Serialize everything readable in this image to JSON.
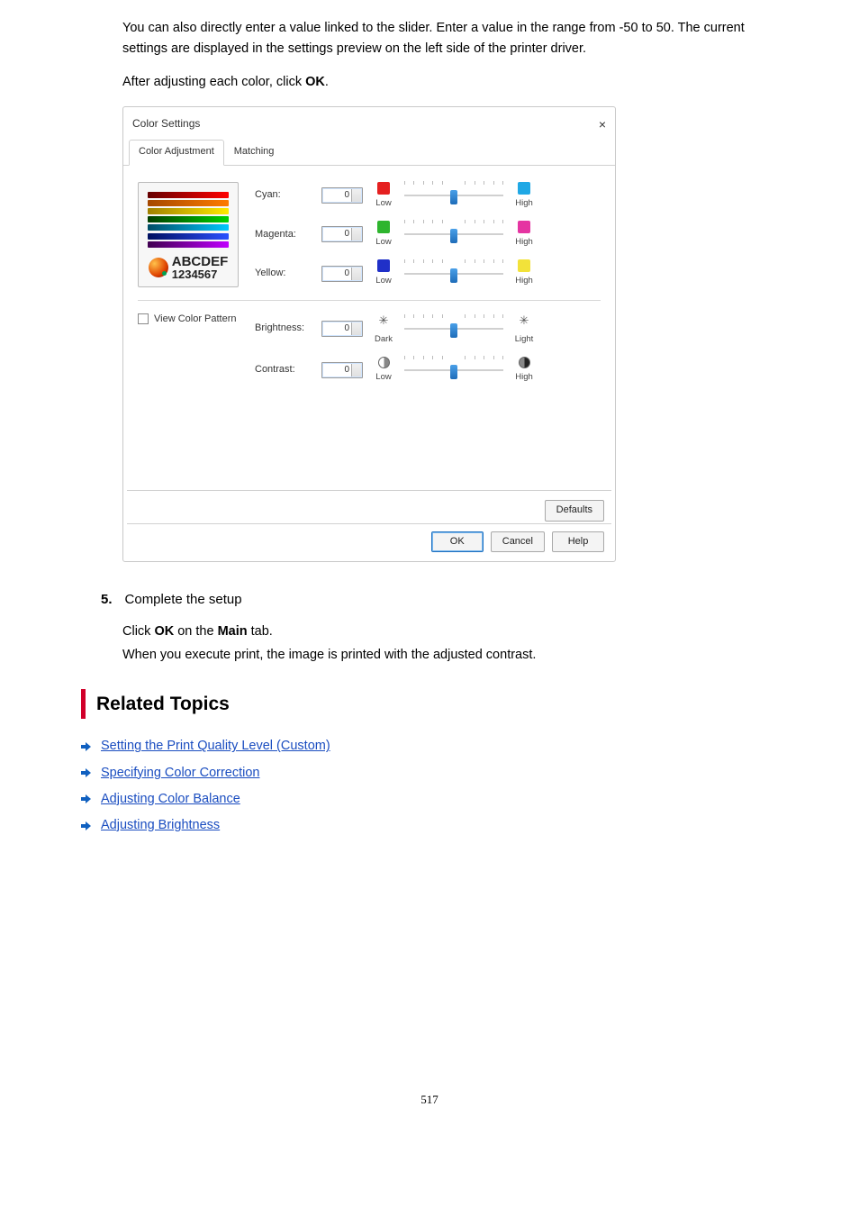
{
  "intro": {
    "p1": "You can also directly enter a value linked to the slider. Enter a value in the range from -50 to 50. The current settings are displayed in the settings preview on the left side of the printer driver.",
    "p2a": "After adjusting each color, click ",
    "p2_bold": "OK",
    "p2b": "."
  },
  "dialog": {
    "title": "Color Settings",
    "close": "×",
    "tabs": {
      "t1": "Color Adjustment",
      "t2": "Matching"
    },
    "sample": {
      "line1": "ABCDEF",
      "line2": "1234567"
    },
    "vcp": "View Color Pattern",
    "rows": {
      "cyan": {
        "label": "Cyan:",
        "val": "0",
        "left": "Low",
        "right": "High"
      },
      "magenta": {
        "label": "Magenta:",
        "val": "0",
        "left": "Low",
        "right": "High"
      },
      "yellow": {
        "label": "Yellow:",
        "val": "0",
        "left": "Low",
        "right": "High"
      },
      "brightness": {
        "label": "Brightness:",
        "val": "0",
        "left": "Dark",
        "right": "Light"
      },
      "contrast": {
        "label": "Contrast:",
        "val": "0",
        "left": "Low",
        "right": "High"
      }
    },
    "buttons": {
      "defaults": "Defaults",
      "ok": "OK",
      "cancel": "Cancel",
      "help": "Help"
    }
  },
  "step5": {
    "num": "5.",
    "title": "Complete the setup",
    "p1a": "Click ",
    "p1_bold1": "OK",
    "p1b": " on the ",
    "p1_bold2": "Main",
    "p1c": " tab.",
    "p2": "When you execute print, the image is printed with the adjusted contrast."
  },
  "related": {
    "heading": "Related Topics",
    "l1": "Setting the Print Quality Level (Custom)",
    "l2": "Specifying Color Correction",
    "l3": "Adjusting Color Balance",
    "l4": "Adjusting Brightness"
  },
  "pagenum": "517"
}
